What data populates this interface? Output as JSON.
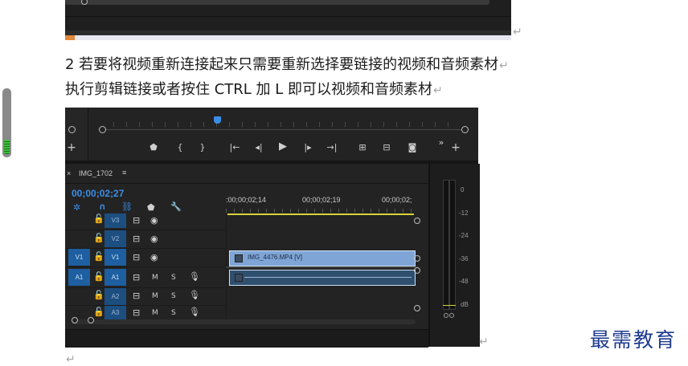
{
  "doc": {
    "para1": "2 若要将视频重新连接起来只需要重新选择要链接的视频和音频素材",
    "para2": "执行剪辑链接或者按住 CTRL 加 L 即可以视频和音频素材",
    "return_mark": "↵"
  },
  "watermark": {
    "text": "最需教育",
    "color": "#1d3a8f"
  },
  "premiere": {
    "panel_title": "IMG_1702",
    "menu_glyph": "≡",
    "close_glyph": "×",
    "timecode": "00;00;02;27",
    "ruler_labels": [
      ":00;00;02;14",
      "00;00;02;19",
      "00;00;02;"
    ],
    "tracks": [
      {
        "src": "",
        "target": "V3",
        "kind": "video"
      },
      {
        "src": "",
        "target": "V2",
        "kind": "video"
      },
      {
        "src": "V1",
        "target": "V1",
        "kind": "video"
      },
      {
        "src": "A1",
        "target": "A1",
        "kind": "audio"
      },
      {
        "src": "",
        "target": "A2",
        "kind": "audio"
      },
      {
        "src": "",
        "target": "A3",
        "kind": "audio"
      }
    ],
    "video_clip_label": "IMG_4476.MP4 [V]",
    "meter_ticks": [
      "0",
      "-12",
      "-24",
      "-36",
      "-48",
      "dB"
    ],
    "accent_color": "#3a8ee6",
    "clip_color": "#7fa5d6"
  }
}
